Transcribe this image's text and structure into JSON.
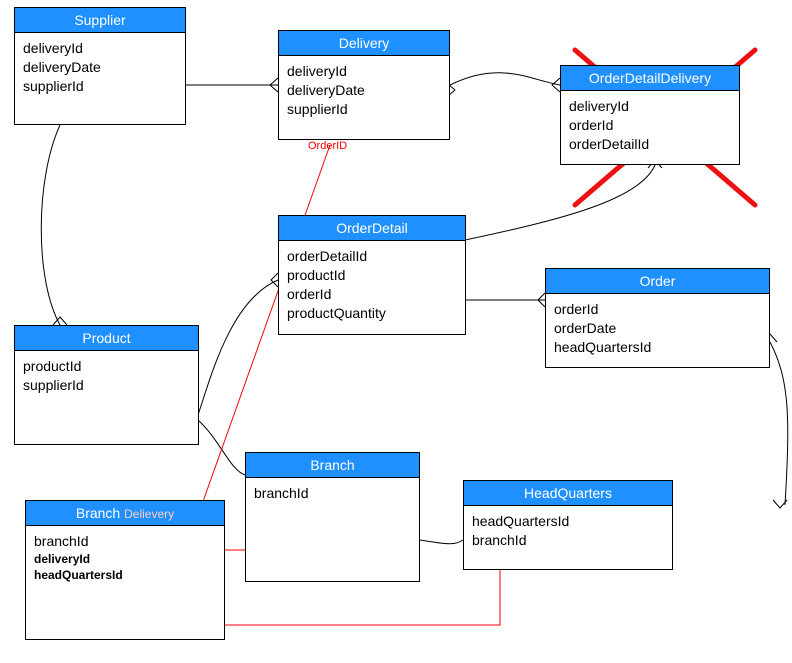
{
  "entities": {
    "supplier": {
      "title": "Supplier",
      "attrs": [
        "deliveryId",
        "deliveryDate",
        "supplierId"
      ]
    },
    "delivery": {
      "title": "Delivery",
      "attrs": [
        "deliveryId",
        "deliveryDate",
        "supplierId"
      ],
      "annotation": "OrderID"
    },
    "orderDetailDelivery": {
      "title": "OrderDetailDelivery",
      "attrs": [
        "deliveryId",
        "orderId",
        "orderDetailId"
      ]
    },
    "orderDetail": {
      "title": "OrderDetail",
      "attrs": [
        "orderDetailId",
        "productId",
        "orderId",
        "productQuantity"
      ]
    },
    "order": {
      "title": "Order",
      "attrs": [
        "orderId",
        "orderDate",
        "headQuartersId"
      ]
    },
    "product": {
      "title": "Product",
      "attrs": [
        "productId",
        "supplierId"
      ]
    },
    "branch": {
      "title": "Branch",
      "attrs": [
        "branchId"
      ]
    },
    "headQuarters": {
      "title": "HeadQuarters",
      "attrs": [
        "headQuartersId",
        "branchId"
      ]
    },
    "branchDelivery": {
      "title": "Branch",
      "titleSuffix": "Delievery",
      "attrs": [
        "branchId",
        "deliveryId",
        "headQuartersId"
      ]
    }
  },
  "chart_data": {
    "type": "table",
    "description": "Entity-Relationship Diagram",
    "entities": [
      {
        "name": "Supplier",
        "attributes": [
          "deliveryId",
          "deliveryDate",
          "supplierId"
        ]
      },
      {
        "name": "Delivery",
        "attributes": [
          "deliveryId",
          "deliveryDate",
          "supplierId",
          "OrderID"
        ],
        "note": "OrderID added in red"
      },
      {
        "name": "OrderDetailDelivery",
        "attributes": [
          "deliveryId",
          "orderId",
          "orderDetailId"
        ],
        "note": "crossed out (deleted)"
      },
      {
        "name": "OrderDetail",
        "attributes": [
          "orderDetailId",
          "productId",
          "orderId",
          "productQuantity"
        ]
      },
      {
        "name": "Order",
        "attributes": [
          "orderId",
          "orderDate",
          "headQuartersId"
        ]
      },
      {
        "name": "Product",
        "attributes": [
          "productId",
          "supplierId"
        ]
      },
      {
        "name": "Branch",
        "attributes": [
          "branchId"
        ]
      },
      {
        "name": "HeadQuarters",
        "attributes": [
          "headQuartersId",
          "branchId"
        ]
      },
      {
        "name": "BranchDelievery",
        "attributes": [
          "branchId",
          "deliveryId",
          "headQuartersId"
        ],
        "note": "Delievery suffix added in red"
      }
    ],
    "relationships": [
      {
        "from": "Supplier",
        "to": "Delivery"
      },
      {
        "from": "Supplier",
        "to": "Product"
      },
      {
        "from": "Delivery",
        "to": "OrderDetailDelivery"
      },
      {
        "from": "OrderDetail",
        "to": "OrderDetailDelivery"
      },
      {
        "from": "OrderDetail",
        "to": "Order"
      },
      {
        "from": "OrderDetail",
        "to": "Product"
      },
      {
        "from": "Product",
        "to": "Branch"
      },
      {
        "from": "Branch",
        "to": "HeadQuarters"
      },
      {
        "from": "HeadQuarters",
        "to": "Order"
      },
      {
        "from": "BranchDelivery",
        "to": "Delivery",
        "color": "red"
      },
      {
        "from": "BranchDelivery",
        "to": "Branch",
        "color": "red"
      },
      {
        "from": "BranchDelivery",
        "to": "HeadQuarters",
        "color": "red"
      }
    ]
  }
}
